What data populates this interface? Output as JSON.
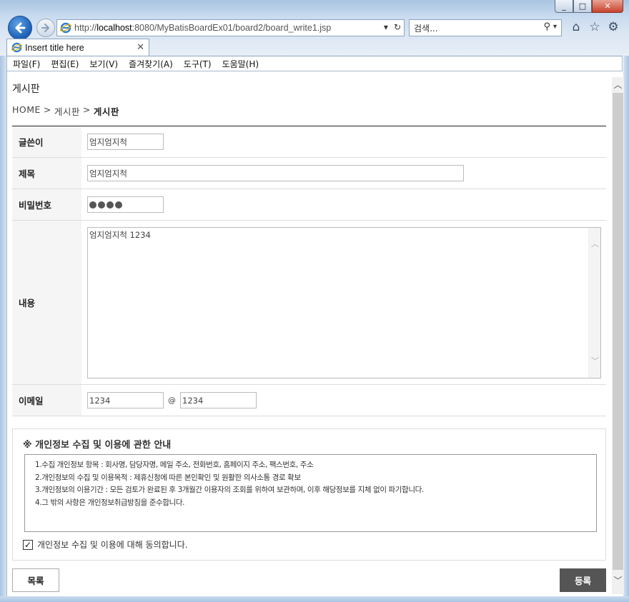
{
  "browser": {
    "window_controls": [
      "_",
      "□",
      "✕"
    ],
    "address": {
      "prefix": "http://",
      "host": "localhost",
      "rest": ":8080/MyBatisBoardEx01/board2/board_write1.jsp"
    },
    "search_placeholder": "검색...",
    "tab_title": "Insert title here",
    "menu": [
      "파일(F)",
      "편집(E)",
      "보기(V)",
      "즐겨찾기(A)",
      "도구(T)",
      "도움말(H)"
    ]
  },
  "page": {
    "title": "게시판",
    "breadcrumb": {
      "home": "HOME",
      "sep": ">",
      "level1": "게시판",
      "current": "게시판"
    }
  },
  "form": {
    "writer_label": "글쓴이",
    "writer_value": "엄지엄지척",
    "subject_label": "제목",
    "subject_value": "엄지엄지척",
    "password_label": "비밀번호",
    "password_length": 4,
    "content_label": "내용",
    "content_value": "엄지엄지척 1234",
    "email_label": "이메일",
    "email_id": "1234",
    "email_at": "@",
    "email_domain": "1234"
  },
  "privacy": {
    "title": "※ 개인정보 수집 및 이용에 관한 안내",
    "lines": [
      "1.수집 개인정보 항목 : 회사명, 담당자명, 메일 주소, 전화번호, 홈페이지 주소, 팩스번호, 주소",
      "2.개인정보의 수집 및 이용목적 : 제휴신청에 따른 본인확인 및 원활한 의사소통 경로 확보",
      "3.개인정보의 이용기간 : 모든 검토가 완료된 후 3개월간 이용자의 조회를 위하여 보관하며, 이후 해당정보를 지체 없이 파기합니다.",
      "4.그 밖의 사항은 개인정보취급방침을 준수합니다."
    ],
    "agree_label": "개인정보 수집 및 이용에 대해 동의합니다.",
    "agree_checked": true
  },
  "buttons": {
    "list": "목록",
    "submit": "등록"
  }
}
